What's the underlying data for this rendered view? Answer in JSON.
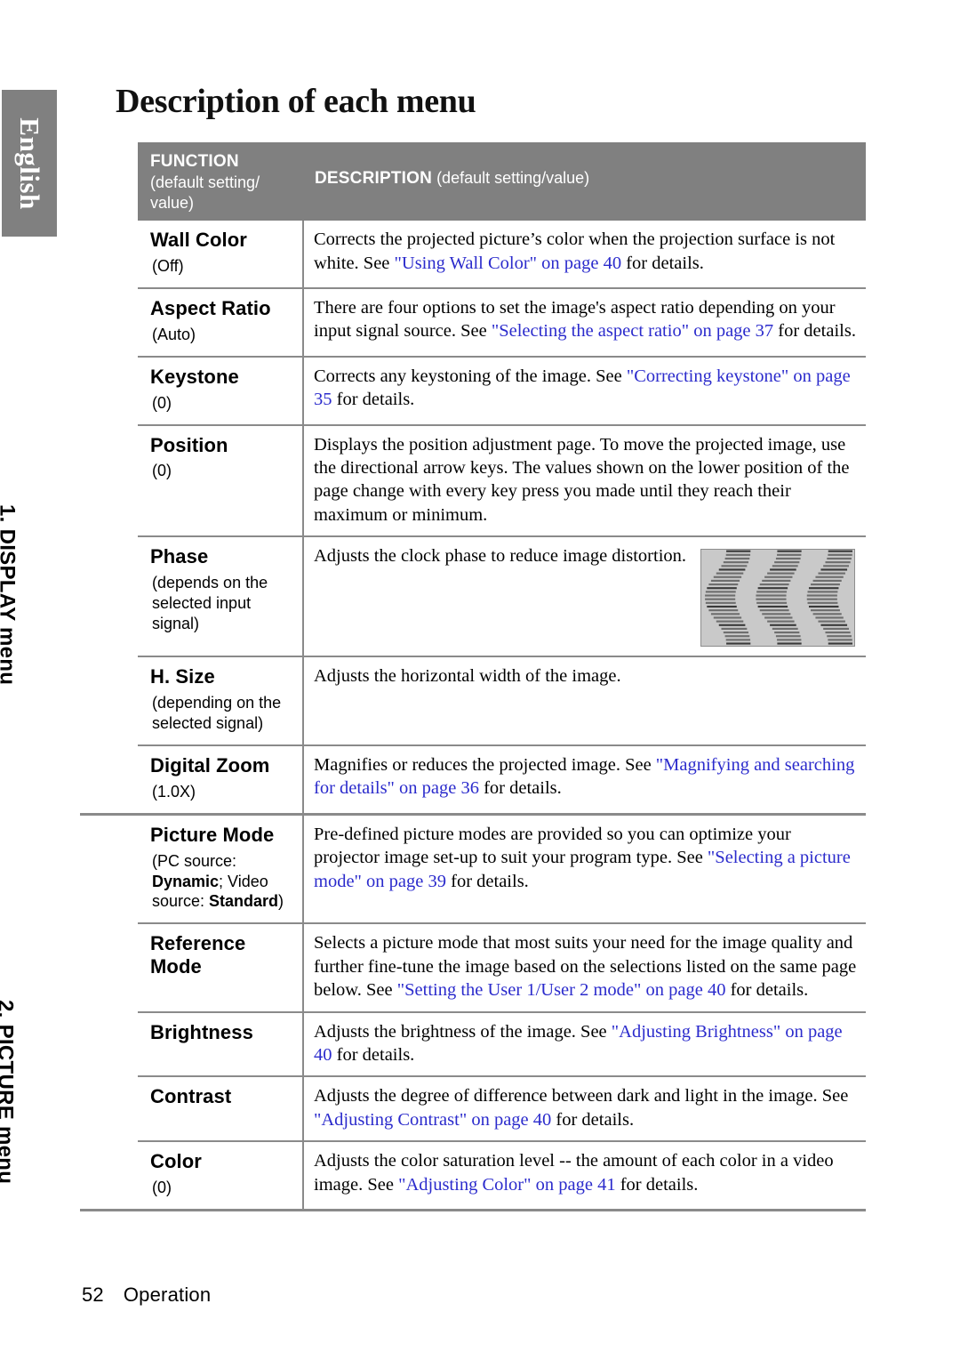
{
  "sidebar": {
    "language_tab": "English"
  },
  "header": {
    "title": "Description of each menu"
  },
  "table": {
    "head": {
      "function_label": "FUNCTION",
      "function_sub": "(default setting/ value)",
      "description_label": "DESCRIPTION",
      "description_sub": "(default setting/value)"
    },
    "sections": [
      {
        "label": "1. DISPLAY menu",
        "rows": [
          {
            "name": "Wall Color",
            "default": "(Off)",
            "desc_parts": [
              {
                "t": "Corrects the projected picture’s color when the projection surface is not white. See ",
                "link": false
              },
              {
                "t": "\"Using Wall Color\" on page 40",
                "link": true
              },
              {
                "t": " for details.",
                "link": false
              }
            ]
          },
          {
            "name": "Aspect Ratio",
            "default": "(Auto)",
            "desc_parts": [
              {
                "t": "There are four options to set the image's aspect ratio depending on your input signal source. See ",
                "link": false
              },
              {
                "t": "\"Selecting the aspect ratio\" on page 37",
                "link": true
              },
              {
                "t": " for details.",
                "link": false
              }
            ]
          },
          {
            "name": "Keystone",
            "default": "(0)",
            "desc_parts": [
              {
                "t": "Corrects any keystoning of the image. See ",
                "link": false
              },
              {
                "t": "\"Correcting keystone\" on page 35",
                "link": true
              },
              {
                "t": " for details.",
                "link": false
              }
            ]
          },
          {
            "name": "Position",
            "default": "(0)",
            "desc_parts": [
              {
                "t": "Displays the position adjustment page. To move the projected image, use the directional arrow keys. The values shown on the lower position of the page change with every key press you made until they reach their maximum or minimum.",
                "link": false
              }
            ]
          },
          {
            "name": "Phase",
            "default": "(depends on the selected input signal)",
            "figure": "phase-distortion-illustration",
            "desc_parts": [
              {
                "t": "Adjusts the clock phase to reduce image distortion.",
                "link": false
              }
            ]
          },
          {
            "name": "H. Size",
            "default": "(depending on the selected signal)",
            "desc_parts": [
              {
                "t": "Adjusts the horizontal width of the image.",
                "link": false
              }
            ]
          },
          {
            "name": "Digital Zoom",
            "default": "(1.0X)",
            "desc_parts": [
              {
                "t": "Magnifies or reduces the projected image. See ",
                "link": false
              },
              {
                "t": "\"Magnifying and searching for details\" on page 36",
                "link": true
              },
              {
                "t": " for details.",
                "link": false
              }
            ]
          }
        ]
      },
      {
        "label": "2. PICTURE menu",
        "rows": [
          {
            "name": "Picture Mode",
            "default_html": "(PC source: <b>Dynamic</b>; Video source: <b>Standard</b>)",
            "desc_parts": [
              {
                "t": "Pre-defined picture modes are provided so you can optimize your projector image set-up to suit your program type. See ",
                "link": false
              },
              {
                "t": "\"Selecting a picture mode\" on page 39",
                "link": true
              },
              {
                "t": " for details.",
                "link": false
              }
            ]
          },
          {
            "name": "Reference Mode",
            "default": "",
            "desc_parts": [
              {
                "t": "Selects a picture mode that most suits your need for the image quality and further fine-tune the image based on the selections listed on the same page below. See ",
                "link": false
              },
              {
                "t": "\"Setting the User 1/User 2 mode\" on page 40",
                "link": true
              },
              {
                "t": " for details.",
                "link": false
              }
            ]
          },
          {
            "name": "Brightness",
            "default": "",
            "desc_parts": [
              {
                "t": "Adjusts the brightness of the image. See ",
                "link": false
              },
              {
                "t": "\"Adjusting Brightness\" on page 40",
                "link": true
              },
              {
                "t": " for details.",
                "link": false
              }
            ]
          },
          {
            "name": "Contrast",
            "default": "",
            "desc_parts": [
              {
                "t": "Adjusts the degree of difference between dark and light in the image. See ",
                "link": false
              },
              {
                "t": "\"Adjusting Contrast\" on page 40",
                "link": true
              },
              {
                "t": " for details.",
                "link": false
              }
            ]
          },
          {
            "name": "Color",
            "default": "(0)",
            "desc_parts": [
              {
                "t": "Adjusts the color saturation level -- the amount of each color in a video image. See ",
                "link": false
              },
              {
                "t": "\"Adjusting Color\" on page 41",
                "link": true
              },
              {
                "t": " for details.",
                "link": false
              }
            ]
          }
        ]
      }
    ]
  },
  "footer": {
    "page_number": "52",
    "section_name": "Operation"
  },
  "colors": {
    "header_gray": "#808080",
    "rule_gray": "#8a8a8a",
    "link_blue": "#2b2bcc",
    "figure_bg": "#c9c9c9"
  }
}
